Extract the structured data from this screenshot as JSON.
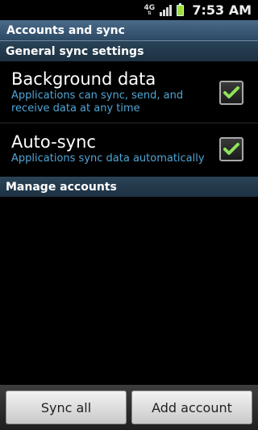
{
  "status_bar": {
    "network": "4G",
    "time": "7:53 AM"
  },
  "header": {
    "title": "Accounts and sync"
  },
  "general": {
    "header": "General sync settings",
    "items": [
      {
        "title": "Background data",
        "subtitle_line1": "Applications can sync, send, and",
        "subtitle_line2": "receive data at any time",
        "checked": true
      },
      {
        "title": "Auto-sync",
        "subtitle_line1": "Applications sync data automatically",
        "checked": true
      }
    ]
  },
  "manage": {
    "header": "Manage accounts"
  },
  "buttons": {
    "sync_all": "Sync all",
    "add_account": "Add account"
  },
  "colors": {
    "subtitle": "#4fa6d6",
    "check": "#8fe15a"
  }
}
